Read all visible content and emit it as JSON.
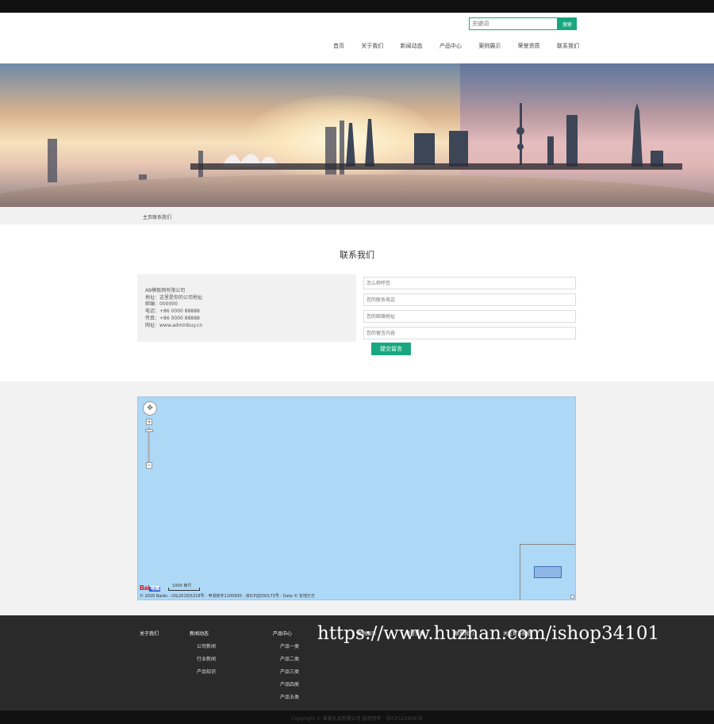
{
  "search": {
    "placeholder": "关键词",
    "button": "搜索"
  },
  "nav": [
    "首页",
    "关于我们",
    "新闻动态",
    "产品中心",
    "案例展示",
    "荣誉资质",
    "联系我们"
  ],
  "breadcrumb": "主页联系我们",
  "contact": {
    "title": "联系我们",
    "info": [
      "AB模板网有限公司",
      "地址：这里是你的公司地址",
      "邮编：000000",
      "电话：+86 0000 88888",
      "传真：+86 0000 88888",
      "网址：www.adminbuy.cn"
    ],
    "form": {
      "name_placeholder": "怎么称呼您",
      "phone_placeholder": "您的联系电话",
      "email_placeholder": "您的邮箱地址",
      "message_placeholder": "您的留言内容",
      "submit": "提交留言"
    }
  },
  "map": {
    "logo": "Bai",
    "logo_suffix": "地图",
    "scale": "1000 英尺",
    "copyright": "© 2020 Baidu - GS(2019)5218号 - 甲测资字1100930 - 京ICP证030173号 - Data © 长地万方"
  },
  "footer": {
    "col1": {
      "head": "关于我们",
      "items": []
    },
    "col2": {
      "head": "新闻动态",
      "items": [
        "公司新闻",
        "行业新闻",
        "产品知识"
      ]
    },
    "col3": {
      "head": "产品中心",
      "items": [
        "产品一类",
        "产品二类",
        "产品三类",
        "产品四类",
        "产品五类"
      ]
    },
    "col4": {
      "head": "案例展示",
      "items": []
    },
    "col5": {
      "head": "荣誉资质",
      "items": []
    },
    "col6": {
      "head": "联系我们",
      "items": []
    },
    "col7": {
      "head": "关注官方微信",
      "items": []
    },
    "watermark": "https://www.huzhan.com/ishop34101"
  },
  "bottom": "Copyright © 某某礼品有限公司 版权所有 · 苏ICP12345678"
}
